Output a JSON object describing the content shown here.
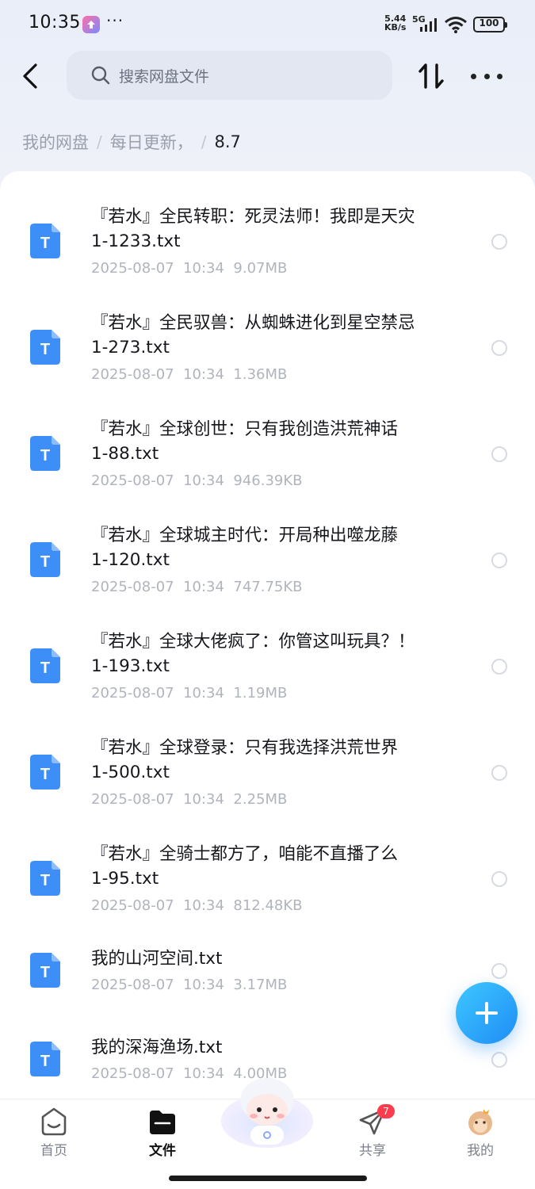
{
  "status_bar": {
    "time": "10:35",
    "dots": "···",
    "net_speed_value": "5.44",
    "net_speed_unit": "KB/s",
    "network_type": "5G",
    "battery": "100"
  },
  "header": {
    "search_placeholder": "搜索网盘文件",
    "icons": {
      "back": "back-arrow-icon",
      "search": "search-icon",
      "sort": "sort-icon",
      "more": "more-icon"
    }
  },
  "breadcrumb": {
    "root": "我的网盘",
    "parent": "每日更新，",
    "separator": "/",
    "current": "8.7"
  },
  "files": [
    {
      "line1": "『若水』全民转职：死灵法师！我即是天灾",
      "line2": "1-1233.txt",
      "date": "2025-08-07",
      "time": "10:34",
      "size": "9.07MB"
    },
    {
      "line1": "『若水』全民驭兽：从蜘蛛进化到星空禁忌",
      "line2": "1-273.txt",
      "date": "2025-08-07",
      "time": "10:34",
      "size": "1.36MB"
    },
    {
      "line1": "『若水』全球创世：只有我创造洪荒神话",
      "line2": "1-88.txt",
      "date": "2025-08-07",
      "time": "10:34",
      "size": "946.39KB"
    },
    {
      "line1": "『若水』全球城主时代：开局种出噬龙藤",
      "line2": "1-120.txt",
      "date": "2025-08-07",
      "time": "10:34",
      "size": "747.75KB"
    },
    {
      "line1": "『若水』全球大佬疯了：你管这叫玩具？！",
      "line2": "1-193.txt",
      "date": "2025-08-07",
      "time": "10:34",
      "size": "1.19MB"
    },
    {
      "line1": "『若水』全球登录：只有我选择洪荒世界",
      "line2": "1-500.txt",
      "date": "2025-08-07",
      "time": "10:34",
      "size": "2.25MB"
    },
    {
      "line1": "『若水』全骑士都方了，咱能不直播了么",
      "line2": "1-95.txt",
      "date": "2025-08-07",
      "time": "10:34",
      "size": "812.48KB"
    },
    {
      "line1": "我的山河空间.txt",
      "line2": "",
      "date": "2025-08-07",
      "time": "10:34",
      "size": "3.17MB"
    },
    {
      "line1": "我的深海渔场.txt",
      "line2": "",
      "date": "2025-08-07",
      "time": "10:34",
      "size": "4.00MB"
    }
  ],
  "file_icon_letter": "T",
  "bottom_nav": {
    "home": "首页",
    "files": "文件",
    "share": "共享",
    "share_badge": "7",
    "mine": "我的"
  },
  "colors": {
    "accent": "#2b8cf6",
    "file_icon": "#3d8ef7",
    "badge": "#ff3b4e"
  }
}
